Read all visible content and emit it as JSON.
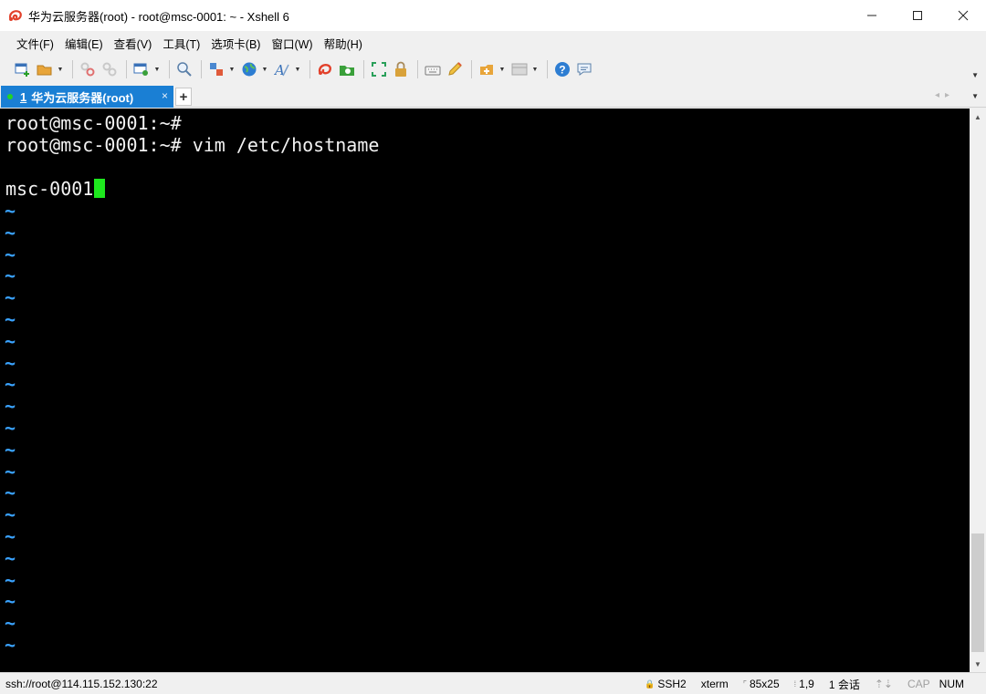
{
  "window": {
    "title": "华为云服务器(root) - root@msc-0001: ~ - Xshell 6",
    "icon": "xshell-logo-icon",
    "controls": [
      "minimize-icon",
      "maximize-icon",
      "close-icon"
    ]
  },
  "menu": {
    "items": [
      "文件(F)",
      "编辑(E)",
      "查看(V)",
      "工具(T)",
      "选项卡(B)",
      "窗口(W)",
      "帮助(H)"
    ]
  },
  "toolbar": {
    "icons": [
      "new-session-icon",
      "open-folder-icon",
      "connect-icon",
      "disconnect-icon",
      "properties-icon",
      "find-icon",
      "transfer-icon",
      "globe-icon",
      "font-icon",
      "xshell-icon",
      "xftp-icon",
      "fullscreen-icon",
      "lock-icon",
      "keyboard-icon",
      "highlight-icon",
      "script-icon",
      "layout-icon",
      "help-icon",
      "chat-icon"
    ]
  },
  "tabs": {
    "active": {
      "number": "1",
      "label": "华为云服务器(root)",
      "close": "×"
    },
    "add_label": "+"
  },
  "terminal": {
    "lines": [
      "root@msc-0001:~#",
      "root@msc-0001:~# vim /etc/hostname",
      "",
      "msc-0001"
    ],
    "tilde": "~",
    "tilde_count": 21,
    "colors": {
      "background": "#000000",
      "text": "#f2f2f2",
      "tilde": "#3aa3ff",
      "cursor": "#1ee81e"
    }
  },
  "status": {
    "connection": "ssh://root@114.115.152.130:22",
    "protocol": "SSH2",
    "term_type": "xterm",
    "size": "85x25",
    "position": "1,9",
    "sessions": "1 会话",
    "cap": "CAP",
    "num": "NUM"
  },
  "colors": {
    "tab_active": "#1a7fd4",
    "chrome": "#f0f0f0"
  }
}
